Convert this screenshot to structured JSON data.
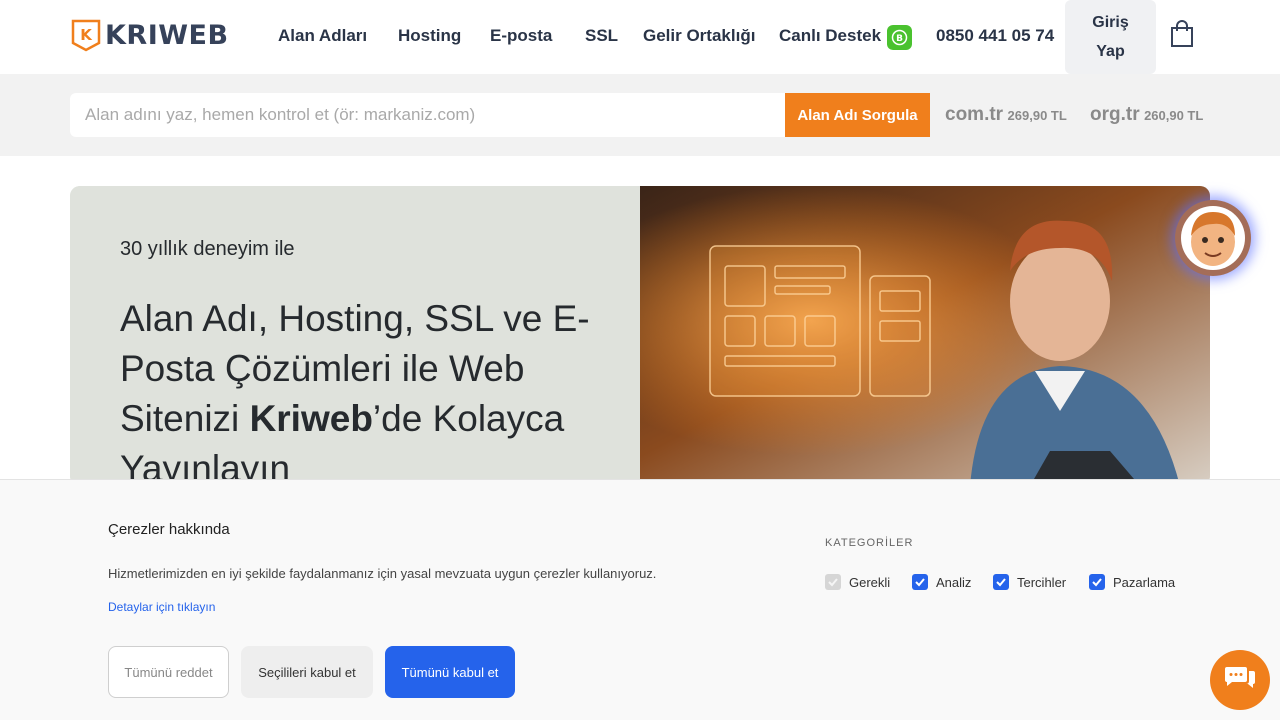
{
  "header": {
    "logo_text": "KRIWEB",
    "logo_letter": "K",
    "nav": [
      {
        "label": "Alan Adları"
      },
      {
        "label": "Hosting"
      },
      {
        "label": "E-posta"
      },
      {
        "label": "SSL"
      },
      {
        "label": "Gelir Ortaklığı"
      }
    ],
    "live_support": "Canlı Destek",
    "phone": "0850 441 05 74",
    "login_line1": "Giriş",
    "login_line2": "Yap"
  },
  "search": {
    "placeholder": "Alan adını yaz, hemen kontrol et (ör: markaniz.com)",
    "button": "Alan Adı Sorgula",
    "tlds": [
      {
        "name": "com.tr",
        "price": "269,90 TL"
      },
      {
        "name": "org.tr",
        "price": "260,90 TL"
      }
    ]
  },
  "hero": {
    "kicker": "30 yıllık deneyim ile",
    "title_pre": "Alan Adı, Hosting, SSL ve E-Posta Çözümleri ile Web Sitenizi ",
    "title_brand": "Kriweb",
    "title_post": "’de Kolayca Yayınlayın"
  },
  "cookie": {
    "title": "Çerezler hakkında",
    "text": "Hizmetlerimizden en iyi şekilde faydalanmanız için yasal mevzuata uygun çerezler kullanıyoruz.",
    "link": "Detaylar için tıklayın",
    "categories_title": "KATEGORİLER",
    "categories": [
      {
        "label": "Gerekli",
        "checked": true,
        "disabled": true
      },
      {
        "label": "Analiz",
        "checked": true,
        "disabled": false
      },
      {
        "label": "Tercihler",
        "checked": true,
        "disabled": false
      },
      {
        "label": "Pazarlama",
        "checked": true,
        "disabled": false
      }
    ],
    "reject_all": "Tümünü reddet",
    "accept_selected": "Seçilileri kabul et",
    "accept_all": "Tümünü kabul et"
  },
  "colors": {
    "accent": "#f07f1c",
    "brand_dark": "#36425a",
    "primary_blue": "#2563eb",
    "whatsapp": "#4ac22f"
  },
  "icons": {
    "cart": "shopping-bag-icon",
    "whatsapp": "whatsapp-icon",
    "chat": "chat-icon",
    "mascot": "mascot-avatar"
  }
}
